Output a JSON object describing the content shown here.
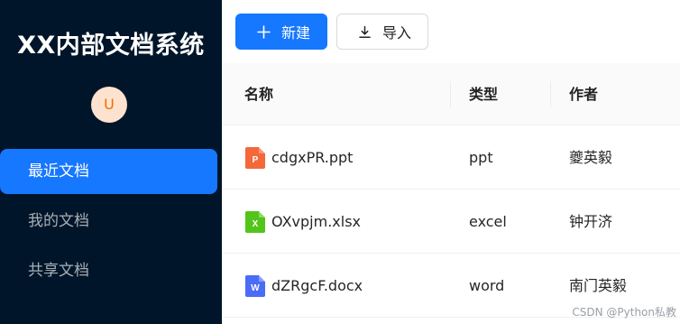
{
  "sidebar": {
    "title": "XX内部文档系统",
    "avatar_letter": "U",
    "items": [
      {
        "label": "最近文档",
        "active": true
      },
      {
        "label": "我的文档",
        "active": false
      },
      {
        "label": "共享文档",
        "active": false
      }
    ]
  },
  "toolbar": {
    "new_label": "新建",
    "import_label": "导入"
  },
  "table": {
    "headers": {
      "name": "名称",
      "type": "类型",
      "author": "作者"
    },
    "rows": [
      {
        "name": "cdgxPR.ppt",
        "type": "ppt",
        "author": "夔英毅",
        "icon": "ppt-file-icon",
        "icon_color": "#f4683a",
        "icon_letter": "P"
      },
      {
        "name": "OXvpjm.xlsx",
        "type": "excel",
        "author": "钟开济",
        "icon": "excel-file-icon",
        "icon_color": "#52c41a",
        "icon_letter": "X"
      },
      {
        "name": "dZRgcF.docx",
        "type": "word",
        "author": "南门英毅",
        "icon": "word-file-icon",
        "icon_color": "#4a6cf7",
        "icon_letter": "W"
      }
    ]
  },
  "watermark": "CSDN @Python私教",
  "colors": {
    "sidebar_bg": "#001529",
    "primary": "#1677ff",
    "avatar_bg": "#fde3cf",
    "avatar_fg": "#f56a00"
  }
}
